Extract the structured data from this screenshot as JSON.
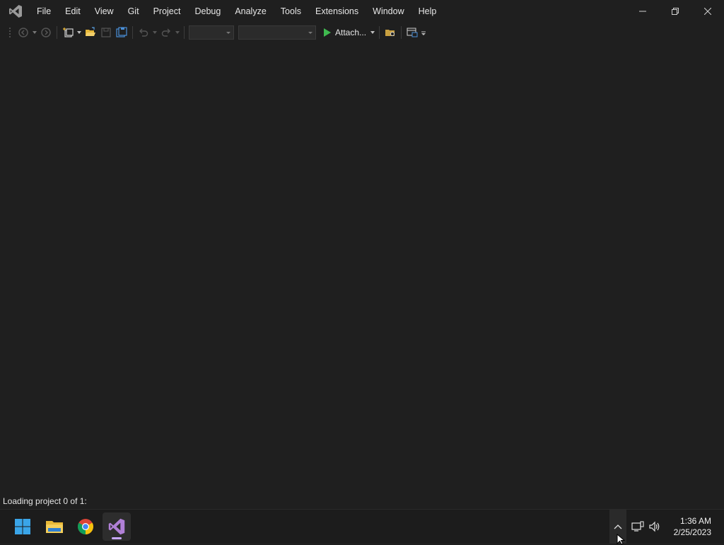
{
  "menu": {
    "items": [
      "File",
      "Edit",
      "View",
      "Git",
      "Project",
      "Debug",
      "Analyze",
      "Tools",
      "Extensions",
      "Window",
      "Help"
    ]
  },
  "toolbar": {
    "attach_label": "Attach...",
    "config_combo_value": "",
    "platform_combo_value": ""
  },
  "status": {
    "text": "Loading project 0 of 1:"
  },
  "taskbar": {
    "apps": [
      "start-icon",
      "file-explorer-icon",
      "chrome-icon",
      "visual-studio-icon"
    ],
    "active_app": "visual-studio-icon"
  },
  "clock": {
    "time": "1:36 AM",
    "date": "2/25/2023"
  },
  "colors": {
    "background": "#1f1f1f",
    "taskbar": "#1c1c1c",
    "vs_purple": "#b180d7",
    "run_green": "#3fb94f",
    "folder_yellow": "#e8b838"
  }
}
